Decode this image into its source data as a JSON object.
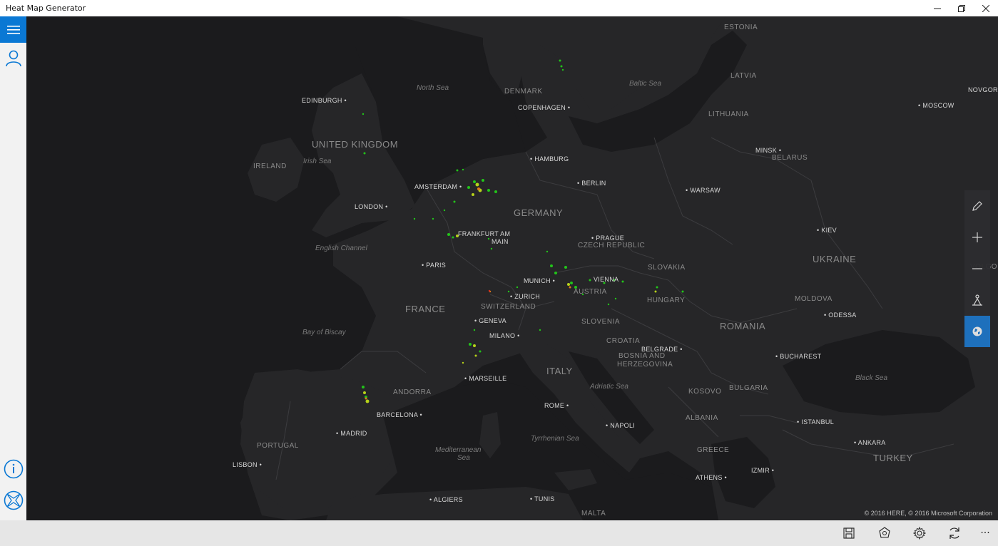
{
  "window": {
    "title": "Heat Map Generator",
    "minimize": "—",
    "restore": "❐",
    "close": "✕"
  },
  "sidebar": {
    "menu_icon": "hamburger-icon",
    "account_icon": "person-icon",
    "info_icon": "info-icon",
    "compass_icon": "compass-icon"
  },
  "map": {
    "countries": [
      {
        "id": "estonia",
        "name": "ESTONIA"
      },
      {
        "id": "latvia",
        "name": "LATVIA"
      },
      {
        "id": "denmark",
        "name": "DENMARK"
      },
      {
        "id": "lithuania",
        "name": "LITHUANIA"
      },
      {
        "id": "uk",
        "name": "UNITED KINGDOM"
      },
      {
        "id": "belarus",
        "name": "BELARUS"
      },
      {
        "id": "ireland",
        "name": "IRELAND"
      },
      {
        "id": "germany",
        "name": "GERMANY"
      },
      {
        "id": "czech",
        "name": "CZECH REPUBLIC"
      },
      {
        "id": "ukraine",
        "name": "UKRAINE"
      },
      {
        "id": "slovakia",
        "name": "SLOVAKIA"
      },
      {
        "id": "austria",
        "name": "AUSTRIA"
      },
      {
        "id": "moldova",
        "name": "MOLDOVA"
      },
      {
        "id": "hungary",
        "name": "HUNGARY"
      },
      {
        "id": "france",
        "name": "FRANCE"
      },
      {
        "id": "switzerland",
        "name": "SWITZERLAND"
      },
      {
        "id": "slovenia",
        "name": "SLOVENIA"
      },
      {
        "id": "romania",
        "name": "ROMANIA"
      },
      {
        "id": "croatia",
        "name": "CROATIA"
      },
      {
        "id": "bosnia1",
        "name": "BOSNIA AND"
      },
      {
        "id": "bosnia2",
        "name": "HERZEGOVINA"
      },
      {
        "id": "italy",
        "name": "ITALY"
      },
      {
        "id": "andorra",
        "name": "ANDORRA"
      },
      {
        "id": "kosovo",
        "name": "KOSOVO"
      },
      {
        "id": "bulgaria",
        "name": "BULGARIA"
      },
      {
        "id": "albania",
        "name": "ALBANIA"
      },
      {
        "id": "portugal",
        "name": "PORTUGAL"
      },
      {
        "id": "greece",
        "name": "GREECE"
      },
      {
        "id": "turkey",
        "name": "TURKEY"
      },
      {
        "id": "malta",
        "name": "MALTA"
      },
      {
        "id": "volgo",
        "name": "VOLGO"
      }
    ],
    "cities": [
      {
        "id": "edinburgh",
        "name": "EDINBURGH"
      },
      {
        "id": "copenhagen",
        "name": "COPENHAGEN"
      },
      {
        "id": "moscow",
        "name": "MOSCOW"
      },
      {
        "id": "novgorod",
        "name": "NOVGOR"
      },
      {
        "id": "hamburg",
        "name": "HAMBURG"
      },
      {
        "id": "minsk",
        "name": "MINSK"
      },
      {
        "id": "amsterdam",
        "name": "AMSTERDAM"
      },
      {
        "id": "berlin",
        "name": "BERLIN"
      },
      {
        "id": "warsaw",
        "name": "WARSAW"
      },
      {
        "id": "london",
        "name": "LONDON"
      },
      {
        "id": "kiev",
        "name": "KIEV"
      },
      {
        "id": "frankfurt1",
        "name": "FRANKFURT AM"
      },
      {
        "id": "frankfurt2",
        "name": "MAIN"
      },
      {
        "id": "prague",
        "name": "PRAGUE"
      },
      {
        "id": "paris",
        "name": "PARIS"
      },
      {
        "id": "munich",
        "name": "MUNICH"
      },
      {
        "id": "vienna",
        "name": "VIENNA"
      },
      {
        "id": "zurich",
        "name": "ZURICH"
      },
      {
        "id": "odessa",
        "name": "ODESSA"
      },
      {
        "id": "geneva",
        "name": "GENEVA"
      },
      {
        "id": "milano",
        "name": "MILANO"
      },
      {
        "id": "belgrade",
        "name": "BELGRADE"
      },
      {
        "id": "bucharest",
        "name": "BUCHAREST"
      },
      {
        "id": "marseille",
        "name": "MARSEILLE"
      },
      {
        "id": "barcelona",
        "name": "BARCELONA"
      },
      {
        "id": "rome",
        "name": "ROME"
      },
      {
        "id": "istanbul",
        "name": "ISTANBUL"
      },
      {
        "id": "madrid",
        "name": "MADRID"
      },
      {
        "id": "napoli",
        "name": "NAPOLI"
      },
      {
        "id": "ankara",
        "name": "ANKARA"
      },
      {
        "id": "lisbon",
        "name": "LISBON"
      },
      {
        "id": "izmir",
        "name": "IZMIR"
      },
      {
        "id": "athens",
        "name": "ATHENS"
      },
      {
        "id": "algiers",
        "name": "ALGIERS"
      },
      {
        "id": "tunis",
        "name": "TUNIS"
      }
    ],
    "seas": [
      {
        "id": "north-sea",
        "name": "North Sea"
      },
      {
        "id": "baltic-sea",
        "name": "Baltic Sea"
      },
      {
        "id": "irish-sea",
        "name": "Irish Sea"
      },
      {
        "id": "english-channel",
        "name": "English Channel"
      },
      {
        "id": "bay-of-biscay",
        "name": "Bay of Biscay"
      },
      {
        "id": "adriatic-sea",
        "name": "Adriatic Sea"
      },
      {
        "id": "black-sea",
        "name": "Black Sea"
      },
      {
        "id": "tyrrhenian-sea",
        "name": "Tyrrhenian Sea"
      },
      {
        "id": "mediterranean-1",
        "name": "Mediterranean"
      },
      {
        "id": "mediterranean-2",
        "name": "Sea"
      }
    ],
    "copyright": "© 2016 HERE, © 2016 Microsoft Corporation",
    "heat_colors": {
      "low": "#22c41a",
      "mid": "#b6d21a",
      "high": "#e07a1a",
      "peak": "#d42a1a"
    }
  },
  "map_tools": [
    {
      "id": "draw",
      "icon": "pencil-icon",
      "active": false
    },
    {
      "id": "zoom-in",
      "icon": "plus-icon",
      "active": false
    },
    {
      "id": "zoom-out",
      "icon": "minus-icon",
      "active": false
    },
    {
      "id": "street",
      "icon": "person-tilt-icon",
      "active": false
    },
    {
      "id": "map-style",
      "icon": "globe-icon",
      "active": true
    }
  ],
  "app_bar": [
    {
      "id": "save",
      "icon": "save-icon"
    },
    {
      "id": "shapes",
      "icon": "shapes-icon"
    },
    {
      "id": "settings",
      "icon": "gear-icon"
    },
    {
      "id": "refresh",
      "icon": "refresh-icon"
    },
    {
      "id": "more",
      "icon": "more-icon",
      "label": "···"
    }
  ],
  "colors": {
    "accent": "#0a78d4",
    "land": "#262628",
    "water": "#1b1b1d",
    "border": "#3c3c3f"
  }
}
